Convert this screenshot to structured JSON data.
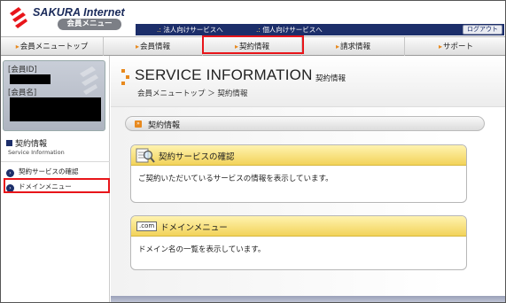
{
  "header": {
    "logo_text": "SAKURA Internet",
    "logo_sub": "会員メニュー",
    "corp_link": "法人向けサービスへ",
    "personal_link": "個人向けサービスへ",
    "logout_label": "ログアウト"
  },
  "nav": {
    "items": [
      {
        "label": "会員メニュートップ"
      },
      {
        "label": "会員情報"
      },
      {
        "label": "契約情報"
      },
      {
        "label": "請求情報"
      },
      {
        "label": "サポート"
      }
    ],
    "active_index": 2
  },
  "sidebar": {
    "member_id_label": "[会員ID]",
    "member_name_label": "[会員名]",
    "section_title": "契約情報",
    "section_sub": "Service Information",
    "items": [
      {
        "label": "契約サービスの確認"
      },
      {
        "label": "ドメインメニュー"
      }
    ],
    "highlighted_index": 1
  },
  "main": {
    "title": "SERVICE INFORMATION",
    "title_jp": "契約情報",
    "breadcrumb": "会員メニュートップ ＞ 契約情報",
    "section_label": "契約情報",
    "panels": [
      {
        "title": "契約サービスの確認",
        "body": "ご契約いただいているサービスの情報を表示しています。"
      },
      {
        "badge": ".com",
        "title": "ドメインメニュー",
        "body": "ドメイン名の一覧を表示しています。"
      }
    ]
  },
  "colors": {
    "navy": "#1c2e6a",
    "accent_orange": "#e8891d",
    "highlight_red": "#e8151a",
    "panel_yellow": "#f2d35a"
  }
}
